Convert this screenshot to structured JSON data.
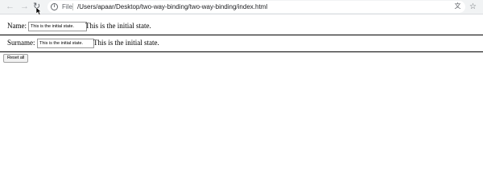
{
  "browser": {
    "back_icon": "arrow-left-icon",
    "forward_icon": "arrow-right-icon",
    "reload_icon": "reload-icon",
    "scheme_label": "File",
    "url": "/Users/apaar/Desktop/two-way-binding/two-way-binding/index.html",
    "translate_icon": "translate-icon",
    "bookmark_icon": "star-icon"
  },
  "form": {
    "name_label": "Name:",
    "name_value": "This is the  initial state.",
    "name_output": "This is the initial state.",
    "surname_label": "Surname:",
    "surname_value": "This is the initial state.",
    "surname_output": "This is the initial state.",
    "reset_label": "Reset all"
  }
}
